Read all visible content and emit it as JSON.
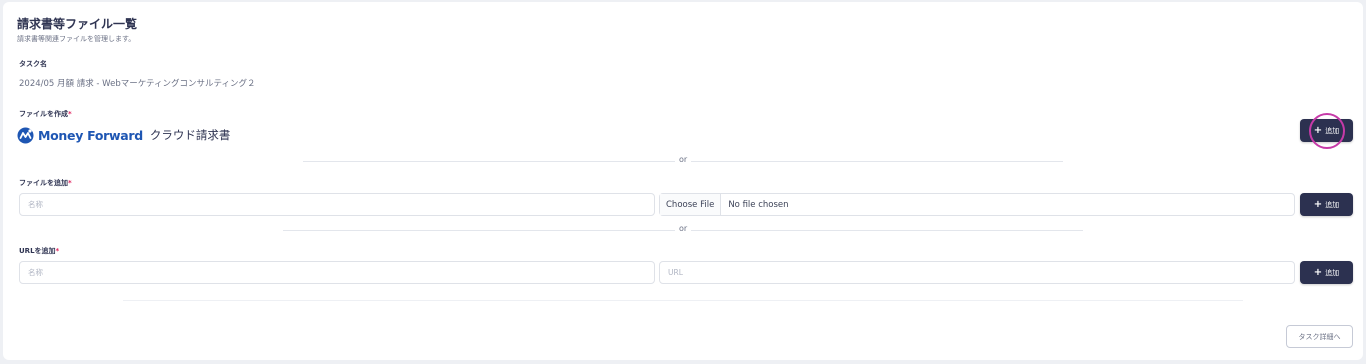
{
  "header": {
    "title": "請求書等ファイル一覧",
    "subtitle": "請求書等関連ファイルを管理します。"
  },
  "task": {
    "label": "タスク名",
    "value": "2024/05 月額 請求 - Webマーケティングコンサルティング２"
  },
  "create_file": {
    "label": "ファイルを作成",
    "required_mark": "*",
    "logo_brand": "Money Forward",
    "logo_product": "クラウド請求書",
    "add_label": "追加",
    "add_icon": "plus-icon"
  },
  "divider_or": "or",
  "add_file": {
    "label": "ファイルを追加",
    "required_mark": "*",
    "name_placeholder": "名称",
    "choose_file_label": "Choose File",
    "no_file_text": "No file chosen",
    "add_label": "追加"
  },
  "add_url": {
    "label": "URLを追加",
    "required_mark": "*",
    "name_placeholder": "名称",
    "url_placeholder": "URL",
    "add_label": "追加"
  },
  "footer": {
    "task_detail_label": "タスク詳細へ"
  },
  "colors": {
    "primary_button": "#2c3150",
    "brand_blue": "#1e56b3",
    "required": "#e0245e",
    "highlight": "#c63aa8"
  }
}
